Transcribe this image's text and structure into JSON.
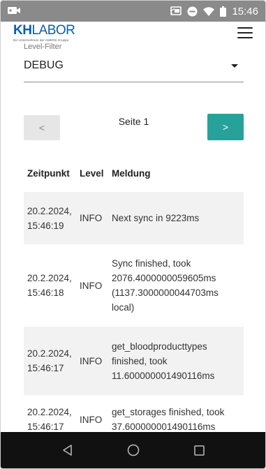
{
  "status_bar": {
    "time": "15:46"
  },
  "header": {
    "logo_kh": "KH",
    "logo_labor": "LABOR",
    "logo_subtitle": "Ein Unternehmen der AMEOS Gruppe"
  },
  "filter": {
    "label": "Level-Filter",
    "value": "DEBUG"
  },
  "pager": {
    "prev": "<",
    "next": ">",
    "page_label": "Seite 1"
  },
  "table": {
    "columns": [
      "Zeitpunkt",
      "Level",
      "Meldung"
    ],
    "rows": [
      {
        "time": "20.2.2024, 15:46:19",
        "level": "INFO",
        "message": "Next sync in 9223ms"
      },
      {
        "time": "20.2.2024, 15:46:18",
        "level": "INFO",
        "message": "Sync finished, took 2076.4000000059605ms (1137.3000000044703ms local)"
      },
      {
        "time": "20.2.2024, 15:46:17",
        "level": "INFO",
        "message": "get_bloodproducttypes finished, took 11.600000001490116ms"
      },
      {
        "time": "20.2.2024, 15:46:17",
        "level": "INFO",
        "message": "get_storages finished, took 37.600000001490116ms"
      }
    ]
  }
}
